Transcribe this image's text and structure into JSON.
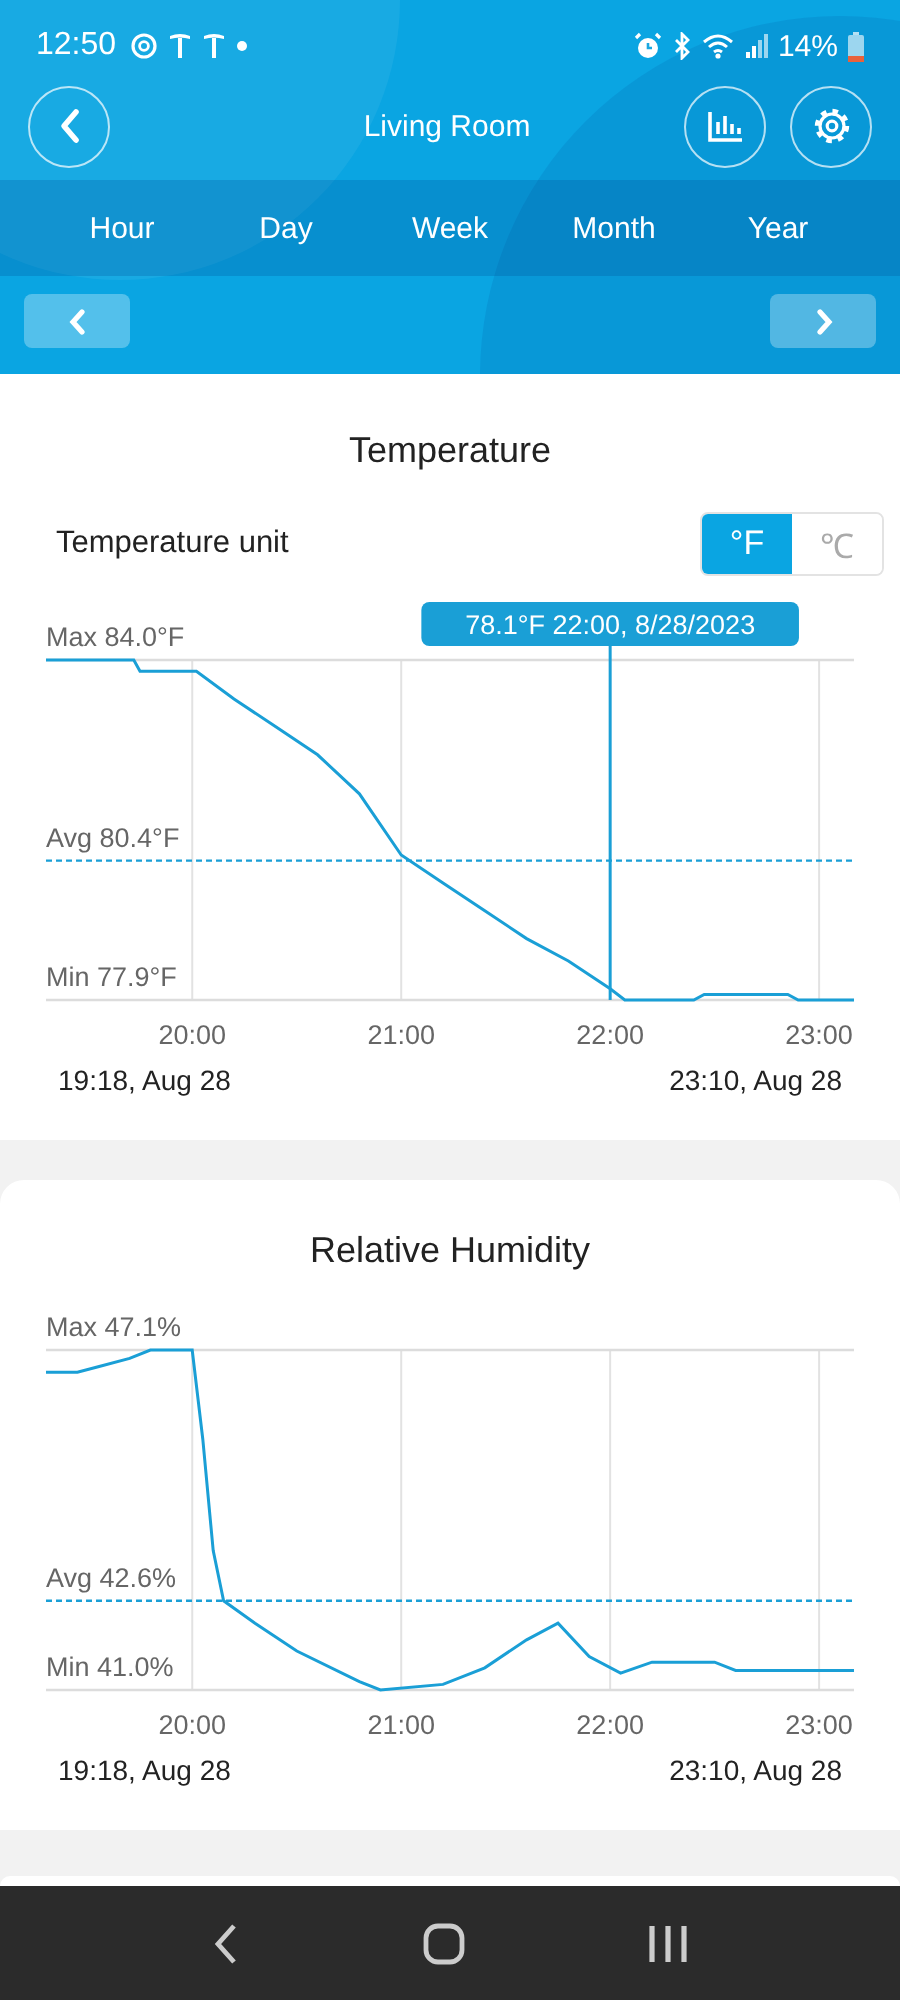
{
  "status_bar": {
    "time": "12:50",
    "battery": "14%"
  },
  "header": {
    "title": "Living Room"
  },
  "tabs": [
    {
      "label": "Hour"
    },
    {
      "label": "Day"
    },
    {
      "label": "Week"
    },
    {
      "label": "Month"
    },
    {
      "label": "Year"
    }
  ],
  "sections": [
    {
      "title": "Temperature",
      "unit_selector": {
        "label": "Temperature unit",
        "options": [
          {
            "label": "°F",
            "selected": true
          },
          {
            "label": "℃",
            "selected": false
          }
        ]
      },
      "chart": {
        "y_labels": [
          {
            "kind": "max",
            "text": "Max 84.0°F"
          },
          {
            "kind": "avg",
            "text": "Avg 80.4°F"
          },
          {
            "kind": "min",
            "text": "Min 77.9°F"
          }
        ],
        "x_labels": [
          "20:00",
          "21:00",
          "22:00",
          "23:00"
        ],
        "tooltip": "78.1°F 22:00, 8/28/2023"
      },
      "range": {
        "start": "19:18, Aug 28",
        "end": "23:10, Aug 28"
      }
    },
    {
      "title": "Relative Humidity",
      "chart": {
        "y_labels": [
          {
            "kind": "max",
            "text": "Max 47.1%"
          },
          {
            "kind": "avg",
            "text": "Avg 42.6%"
          },
          {
            "kind": "min",
            "text": "Min 41.0%"
          }
        ],
        "x_labels": [
          "20:00",
          "21:00",
          "22:00",
          "23:00"
        ]
      },
      "range": {
        "start": "19:18, Aug 28",
        "end": "23:10, Aug 28"
      }
    }
  ]
}
